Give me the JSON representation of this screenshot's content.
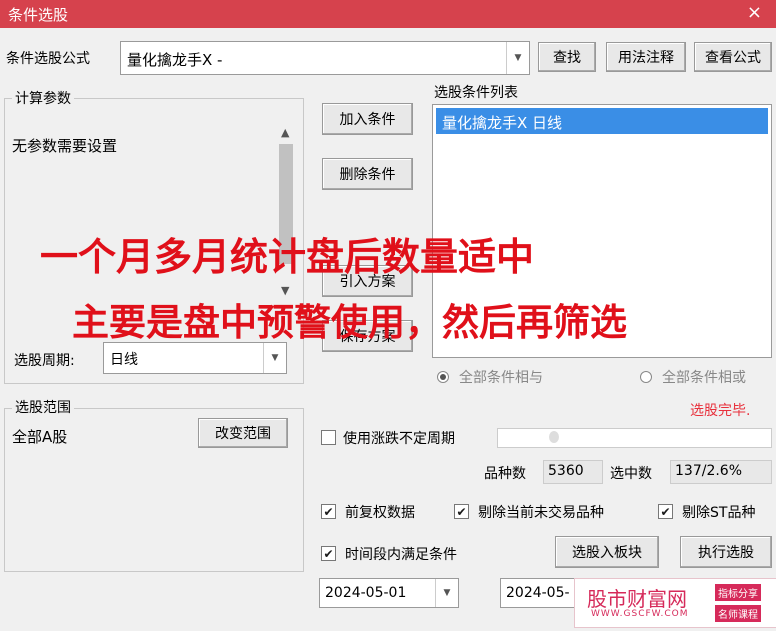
{
  "window": {
    "title": "条件选股",
    "close_glyph": "×"
  },
  "formula": {
    "label": "条件选股公式",
    "value": "量化擒龙手X  -",
    "find": "查找",
    "usage": "用法注释",
    "view": "查看公式"
  },
  "params": {
    "legend": "计算参数",
    "empty_text": "无参数需要设置",
    "period_label": "选股周期:",
    "period_value": "日线"
  },
  "actions": {
    "add": "加入条件",
    "delete": "删除条件",
    "import": "引入方案",
    "save": "保存方案"
  },
  "conditions": {
    "legend": "选股条件列表",
    "items": [
      "量化擒龙手X  日线"
    ]
  },
  "logic": {
    "and_label": "全部条件相与",
    "or_label": "全部条件相或",
    "selected": "and"
  },
  "status": {
    "text": "选股完毕.",
    "color": "#e8303c"
  },
  "scope": {
    "legend": "选股范围",
    "value": "全部A股",
    "change": "改变范围"
  },
  "options": {
    "volatile_period": {
      "label": "使用涨跌不定周期",
      "checked": false
    },
    "count_label": "品种数",
    "count_value": "5360",
    "hits_label": "选中数",
    "hits_value": "137/2.6%",
    "prev_adjusted": {
      "label": "前复权数据",
      "checked": true
    },
    "exclude_untraded": {
      "label": "剔除当前未交易品种",
      "checked": true
    },
    "exclude_st": {
      "label": "剔除ST品种",
      "checked": true
    },
    "time_range": {
      "label": "时间段内满足条件",
      "checked": true
    },
    "to_block": "选股入板块",
    "run": "执行选股",
    "start_date": "2024-05-01",
    "end_date": "2024-05-"
  },
  "overlay": {
    "line1": "一个月多月统计盘后数量适中",
    "line2": "主要是盘中预警使用，然后再筛选"
  },
  "watermark": {
    "name": "股市财富网",
    "url": "WWW.GSCFW.COM",
    "tag1": "指标分享",
    "tag2": "名师课程"
  },
  "colors": {
    "title_bar": "#d6424d",
    "selection": "#3a8ee6",
    "overlay": "#e0101a"
  }
}
